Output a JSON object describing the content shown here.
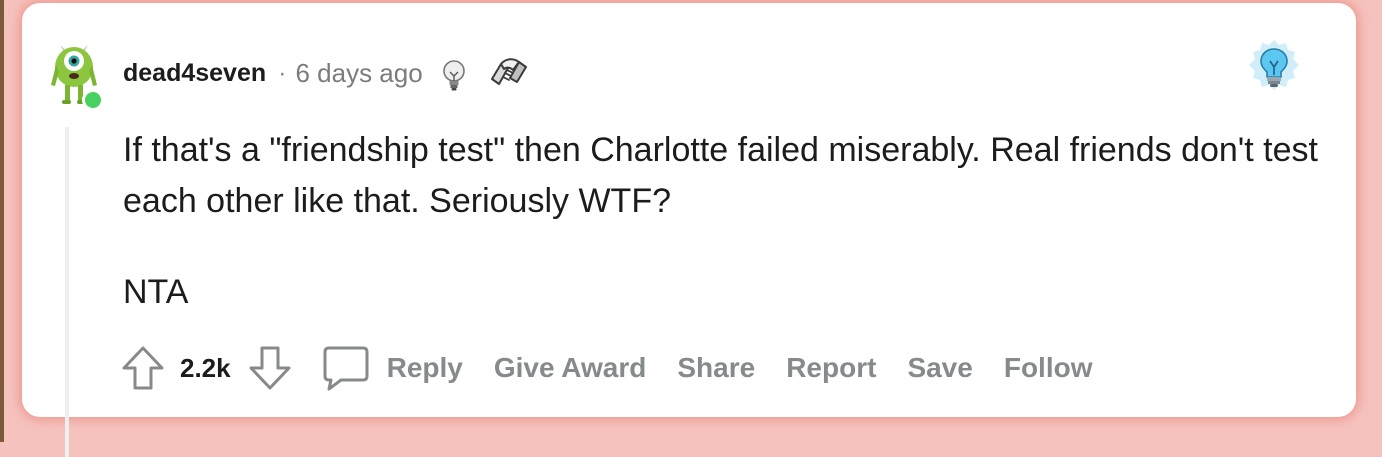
{
  "comment": {
    "author": "dead4seven",
    "separator": "·",
    "timestamp": "6 days ago",
    "body": [
      "If that's a \"friendship test\" then Charlotte failed miserably. Real friends don't test each other like that. Seriously WTF?",
      "NTA"
    ],
    "score": "2.2k",
    "icons": {
      "avatar": "avatar",
      "online_status": "online-status-dot",
      "award_1": "lightbulb-award-icon",
      "award_2": "handshake-award-icon",
      "flair": "blue-lightbulb-flair-icon"
    }
  },
  "actions": {
    "upvote_icon": "upvote-arrow-icon",
    "downvote_icon": "downvote-arrow-icon",
    "comment_icon": "comment-bubble-icon",
    "reply_label": "Reply",
    "give_award_label": "Give Award",
    "share_label": "Share",
    "report_label": "Report",
    "save_label": "Save",
    "follow_label": "Follow"
  },
  "colors": {
    "page_background": "#f6c2bd",
    "card_background": "#ffffff",
    "online": "#46d160",
    "action_text": "#878a8c",
    "text": "#1c1c1c"
  }
}
